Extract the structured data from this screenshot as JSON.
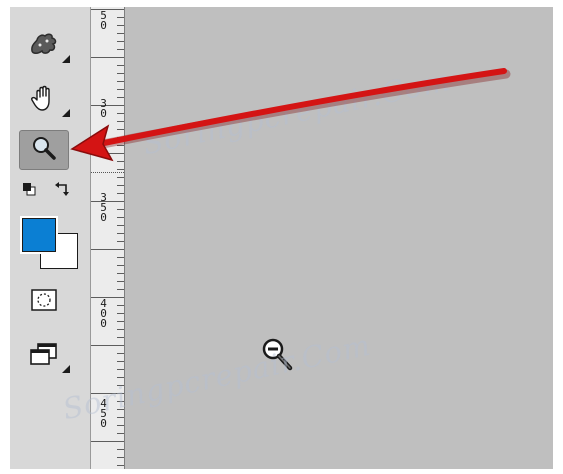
{
  "toolbar": {
    "tools": [
      {
        "name": "puppet-warp-tool",
        "icon": "puppet-icon",
        "active": false
      },
      {
        "name": "hand-tool",
        "icon": "hand-icon",
        "active": false
      },
      {
        "name": "zoom-tool",
        "icon": "zoom-magnifier-icon",
        "active": true
      }
    ],
    "swap_colors_icon": "swap-colors-icon",
    "default_colors_icon": "default-colors-icon",
    "foreground_color": "#0b7fd3",
    "background_color": "#ffffff",
    "quick_mask_icon": "quick-mask-icon",
    "screen_mode_icon": "screen-mode-icon"
  },
  "ruler": {
    "labels": [
      "5\n0",
      "3\n0",
      "3\n5\n0",
      "4\n0\n0",
      "4\n5\n0"
    ]
  },
  "canvas": {
    "cursor_icon": "zoom-out-cursor-icon"
  },
  "watermark": {
    "lines": [
      "Soringpcrepair.Com",
      "Soringpcrepair.Com"
    ]
  },
  "annotation": {
    "arrow_color": "#d41414"
  }
}
